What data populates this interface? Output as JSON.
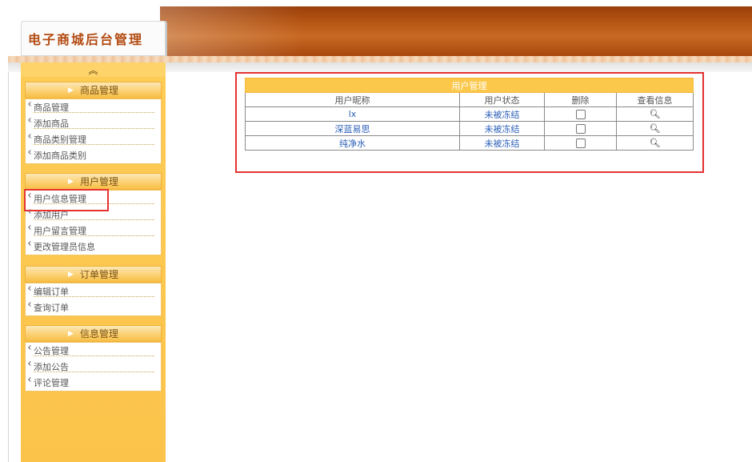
{
  "header": {
    "logo_text": "电子商城后台管理"
  },
  "sidebar": {
    "collapse_icon": "double-chevron-up-icon",
    "collapse_glyph": "︽",
    "groups": [
      {
        "title": "商品管理",
        "items": [
          "商品管理",
          "添加商品",
          "商品类别管理",
          "添加商品类别"
        ]
      },
      {
        "title": "用户管理",
        "items": [
          "用户信息管理",
          "添加用户",
          "用户留言管理",
          "更改管理员信息"
        ]
      },
      {
        "title": "订单管理",
        "items": [
          "编辑订单",
          "查询订单"
        ]
      },
      {
        "title": "信息管理",
        "items": [
          "公告管理",
          "添加公告",
          "评论管理"
        ]
      }
    ],
    "selected_item": "用户信息管理"
  },
  "main": {
    "table": {
      "caption": "用户管理",
      "columns": [
        "用户昵称",
        "用户状态",
        "删除",
        "查看信息"
      ],
      "rows": [
        {
          "nickname": "lx",
          "status": "未被冻结"
        },
        {
          "nickname": "深蓝易思",
          "status": "未被冻结"
        },
        {
          "nickname": "纯净水",
          "status": "未被冻结"
        }
      ],
      "view_icon": "magnifier-icon"
    }
  },
  "colors": {
    "accent": "#fbc84b",
    "header": "#b85816",
    "highlight": "#e53232",
    "link": "#2b5fb8"
  }
}
